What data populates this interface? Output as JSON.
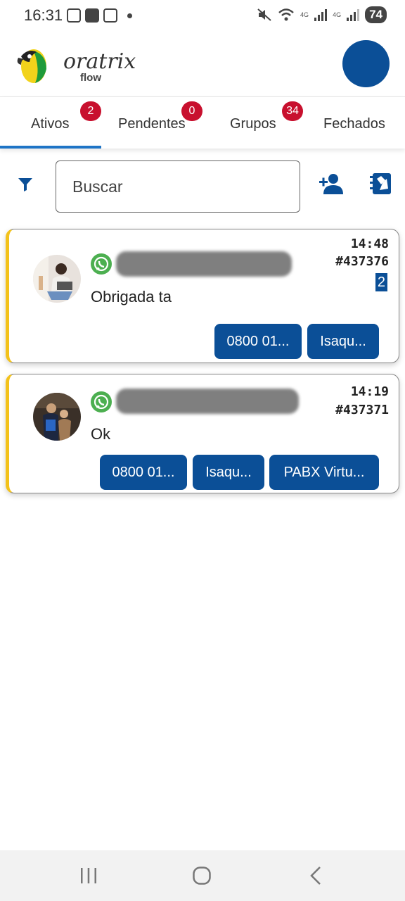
{
  "status_bar": {
    "time": "16:31",
    "network_1": "4G",
    "network_2": "4G",
    "battery": "74"
  },
  "header": {
    "logo_text": "oratrix",
    "logo_sub": "flow"
  },
  "tabs": [
    {
      "label": "Ativos",
      "badge": "2",
      "active": true
    },
    {
      "label": "Pendentes",
      "badge": "0",
      "active": false
    },
    {
      "label": "Grupos",
      "badge": "34",
      "active": false
    },
    {
      "label": "Fechados",
      "badge": "",
      "active": false
    }
  ],
  "search": {
    "placeholder": "Buscar"
  },
  "tickets": [
    {
      "message": "Obrigada ta",
      "time": "14:48",
      "ticket_id": "#437376",
      "unread": "2",
      "tags": [
        "0800 01...",
        "Isaqu..."
      ]
    },
    {
      "message": "Ok",
      "time": "14:19",
      "ticket_id": "#437371",
      "unread": "",
      "tags": [
        "0800 01...",
        "Isaqu...",
        "PABX Virtu..."
      ]
    }
  ],
  "colors": {
    "primary": "#0b4f97",
    "badge": "#c8102e",
    "tab_underline": "#1e74c6",
    "card_accent": "#f3c21b",
    "whatsapp": "#4caf50"
  }
}
